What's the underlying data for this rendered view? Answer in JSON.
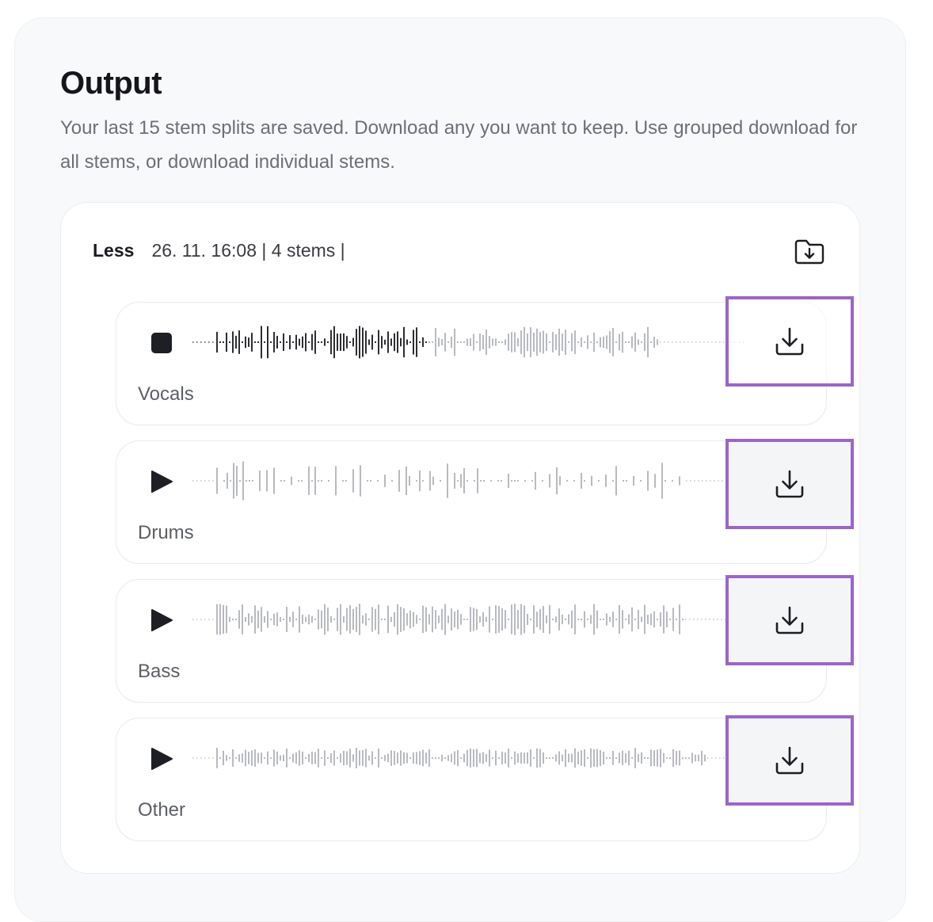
{
  "header": {
    "title": "Output",
    "description": "Your last 15 stem splits are saved. Download any you want to keep. Use grouped download for all stems, or download individual stems."
  },
  "group": {
    "name": "Less",
    "meta": "26. 11. 16:08 | 4 stems |",
    "download_all_icon": "folder-download-icon"
  },
  "stems": [
    {
      "label": "Vocals",
      "state": "playing",
      "control_icon": "stop-icon",
      "download_icon": "download-icon"
    },
    {
      "label": "Drums",
      "state": "paused",
      "control_icon": "play-icon",
      "download_icon": "download-icon"
    },
    {
      "label": "Bass",
      "state": "paused",
      "control_icon": "play-icon",
      "download_icon": "download-icon"
    },
    {
      "label": "Other",
      "state": "paused",
      "control_icon": "play-icon",
      "download_icon": "download-icon"
    }
  ],
  "colors": {
    "highlight": "#9b65c9",
    "waveform_played": "#2d2e33",
    "waveform_unplayed": "#b8bac0"
  }
}
